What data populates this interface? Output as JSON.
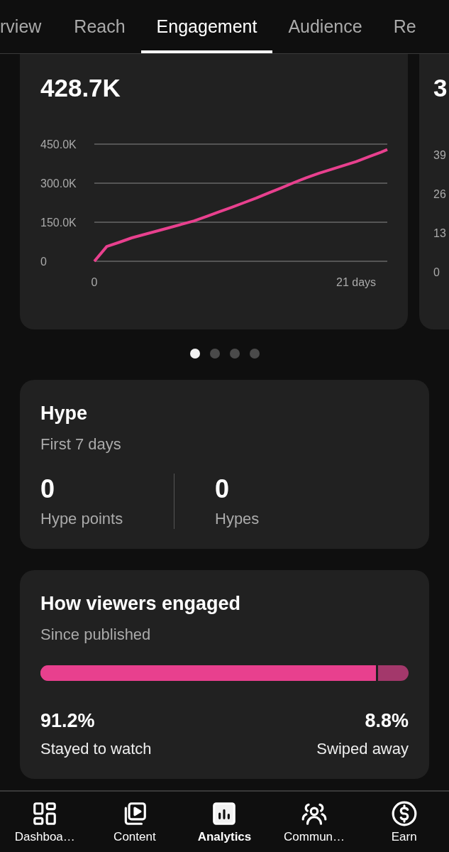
{
  "tabs": [
    {
      "label": "rview",
      "selected": false
    },
    {
      "label": "Reach",
      "selected": false
    },
    {
      "label": "Engagement",
      "selected": true
    },
    {
      "label": "Audience",
      "selected": false
    },
    {
      "label": "Re",
      "selected": false
    }
  ],
  "metric_card": {
    "value": "428.7K",
    "chart_data": {
      "type": "line",
      "x": [
        0,
        1,
        2,
        3,
        4,
        5,
        6,
        7,
        8,
        9,
        10,
        11,
        12,
        13,
        14,
        15,
        16,
        17,
        18,
        19,
        20,
        21,
        22,
        23,
        23.5
      ],
      "series": [
        {
          "color": "#e8408e",
          "values": [
            0,
            57000,
            73000,
            90000,
            103000,
            116000,
            129000,
            142000,
            155000,
            172000,
            190000,
            207000,
            225000,
            243000,
            263000,
            282000,
            302000,
            321000,
            338000,
            353000,
            368000,
            383000,
            401000,
            419000,
            429000
          ]
        }
      ],
      "xlim": [
        0,
        23.5
      ],
      "ylim": [
        0,
        450000
      ],
      "xticks": [
        0,
        {
          "value": 21,
          "label": "21 days"
        }
      ],
      "yticks": [
        {
          "value": 0,
          "label": "0"
        },
        {
          "value": 150000,
          "label": "150.0K"
        },
        {
          "value": 300000,
          "label": "300.0K"
        },
        {
          "value": 450000,
          "label": "450.0K"
        }
      ]
    }
  },
  "next_card": {
    "value": "3",
    "axis_labels": [
      "39",
      "26",
      "13",
      "0"
    ]
  },
  "page_dots": [
    {
      "selected": true
    },
    {
      "selected": false
    },
    {
      "selected": false
    },
    {
      "selected": false
    }
  ],
  "hype": {
    "title": "Hype",
    "subtitle": "First 7 days",
    "stats": [
      {
        "value": "0",
        "label": "Hype points"
      },
      {
        "value": "0",
        "label": "Hypes"
      }
    ]
  },
  "engagement": {
    "title": "How viewers engaged",
    "subtitle": "Since published",
    "level": 0.912,
    "stayed": {
      "value": "91.2%",
      "label": "Stayed to watch"
    },
    "swiped": {
      "value": "8.8%",
      "label": "Swiped away"
    }
  },
  "nav": [
    {
      "kind": "dashboard",
      "label": "Dashboa…",
      "selected": false
    },
    {
      "kind": "content",
      "label": "Content",
      "selected": false
    },
    {
      "kind": "analytics",
      "label": "Analytics",
      "selected": true
    },
    {
      "kind": "community",
      "label": "Commun…",
      "selected": false
    },
    {
      "kind": "earn",
      "label": "Earn",
      "selected": false
    }
  ]
}
